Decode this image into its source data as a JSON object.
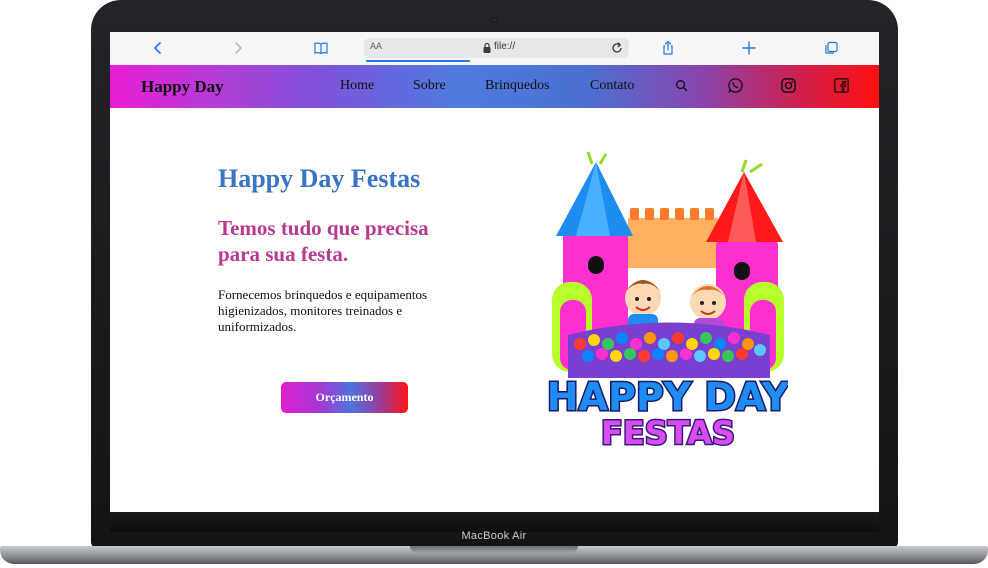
{
  "device": {
    "label": "MacBook Air"
  },
  "browser": {
    "aa_label": "AA",
    "url": "file://"
  },
  "nav": {
    "brand": "Happy Day",
    "links": [
      "Home",
      "Sobre",
      "Brinquedos",
      "Contato"
    ],
    "icons": [
      "search-icon",
      "whatsapp-icon",
      "instagram-icon",
      "facebook-icon"
    ]
  },
  "hero": {
    "title": "Happy Day Festas",
    "subtitle": "Temos tudo que precisa para sua festa.",
    "text": "Fornecemos brinquedos e equipamentos higienizados, monitores treinados e uniformizados.",
    "cta": "Orçamento"
  },
  "logo": {
    "line1": "HAPPY DAY",
    "line2": "FESTAS"
  },
  "colors": {
    "title": "#3a74c2",
    "subtitle": "#b8398f",
    "accent_pink": "#e91ed4",
    "accent_blue": "#4f7be0",
    "accent_red": "#ff1010"
  }
}
